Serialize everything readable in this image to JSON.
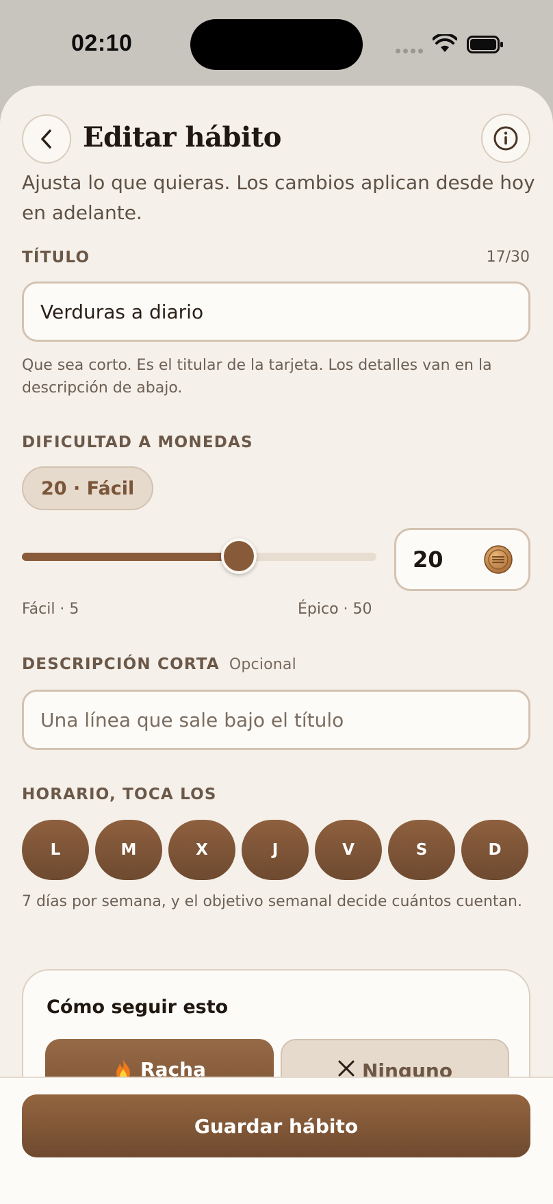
{
  "status_bar": {
    "time": "02:10"
  },
  "header": {
    "title": "Editar hábito"
  },
  "subtitle": "Ajusta lo que quieras. Los cambios aplican desde hoy en adelante.",
  "title_field": {
    "label": "TÍTULO",
    "counter": "17/30",
    "value": "Verduras a diario",
    "helper": "Que sea corto. Es el titular de la tarjeta. Los detalles van en la descripción de abajo."
  },
  "difficulty": {
    "label": "DIFICULTAD A MONEDAS",
    "pill": "20 · Fácil",
    "value": "20",
    "min": 5,
    "max": 50,
    "current": 20,
    "min_label": "Fácil · 5",
    "max_label": "Épico · 50"
  },
  "description": {
    "label": "DESCRIPCIÓN CORTA",
    "optional": "Opcional",
    "placeholder": "Una línea que sale bajo el título"
  },
  "schedule": {
    "label": "HORARIO, TOCA LOS",
    "days": [
      "L",
      "M",
      "X",
      "J",
      "V",
      "S",
      "D"
    ],
    "helper": "7 días por semana, y el objetivo semanal decide cuántos cuentan."
  },
  "tracking": {
    "title": "Cómo seguir esto",
    "options": [
      {
        "label": "Racha",
        "icon": "fire-icon",
        "selected": true
      },
      {
        "label": "Ninguno",
        "icon": "close-icon",
        "selected": false
      }
    ]
  },
  "footer": {
    "save_label": "Guardar hábito"
  },
  "colors": {
    "accent": "#875a39",
    "background": "#f5f0e9",
    "field_border": "#d4c3b2"
  }
}
